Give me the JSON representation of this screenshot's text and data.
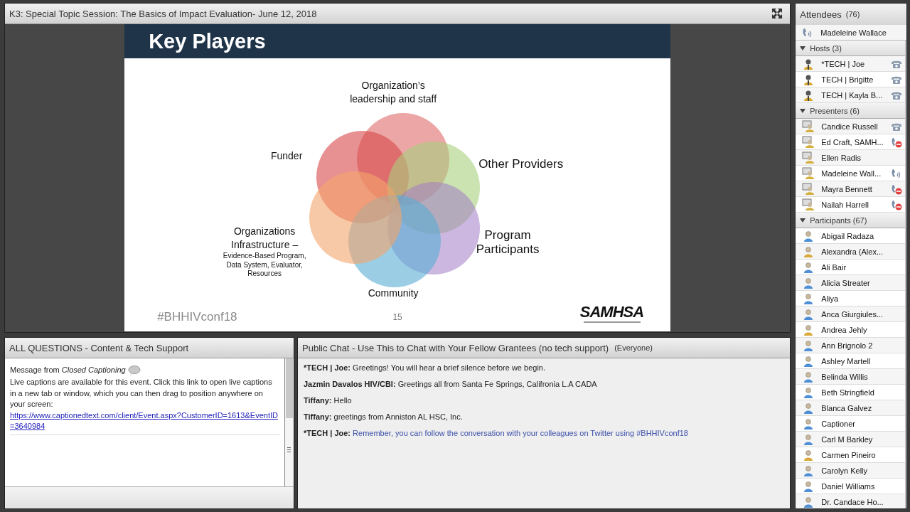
{
  "window": {
    "title": "K3: Special Topic Session: The Basics of Impact Evaluation- June 12, 2018"
  },
  "slide": {
    "title": "Key Players",
    "labels": [
      {
        "text": "Organization’s\nleadership and staff"
      },
      {
        "text": "Funder"
      },
      {
        "text": "Other Providers"
      },
      {
        "text": "Organizations\nInfrastructure –",
        "detail": "Evidence-Based Program,\nData System, Evaluator,\nResources"
      },
      {
        "text": "Program\nParticipants"
      },
      {
        "text": "Community"
      }
    ],
    "hashtag": "#BHHIVconf18",
    "page_number": "15",
    "logo": "SAMHSA"
  },
  "questions_pod": {
    "title": "ALL QUESTIONS - Content & Tech Support",
    "message": {
      "heading": "Message from *Closed Captioning*",
      "body": "Live captions are available for this event. Click this link to open live captions in a new tab or window, which you can then drag to position anywhere on your screen:",
      "link": "https://www.captionedtext.com/client/Event.aspx?CustomerID=1613&EventID=3640984"
    }
  },
  "chat_pod": {
    "title": "Public Chat - Use This to Chat with Your Fellow Grantees (no tech support)",
    "audience": "(Everyone)",
    "messages": [
      {
        "sender": "*TECH | Joe:",
        "text": "Greetings! You will hear a brief silence before we begin.",
        "highlighted": false
      },
      {
        "sender": "Jazmin Davalos HIV/CBI:",
        "text": "Greetings all from Santa Fe Springs, Califronia L.A CADA",
        "highlighted": false
      },
      {
        "sender": "Tiffany:",
        "text": "Hello",
        "highlighted": false
      },
      {
        "sender": "Tiffany:",
        "text": "greetings from Anniston AL HSC, Inc.",
        "highlighted": false
      },
      {
        "sender": "*TECH | Joe:",
        "text": "Remember, you can follow the conversation with your colleagues on Twitter using #BHHIVconf18",
        "highlighted": true
      }
    ]
  },
  "attendees": {
    "title": "Attendees",
    "count": "(76)",
    "current_user": {
      "name": "Madeleine Wallace",
      "kind": "talking"
    },
    "groups": [
      {
        "label": "Hosts (3)",
        "kind": "host",
        "expanded": true,
        "members": [
          {
            "name": "*TECH | Joe",
            "kind": "phone"
          },
          {
            "name": "TECH | Brigitte",
            "kind": "phone"
          },
          {
            "name": "TECH | Kayla B...",
            "kind": "phone"
          }
        ]
      },
      {
        "label": "Presenters (6)",
        "kind": "presenter",
        "expanded": true,
        "members": [
          {
            "name": "Candice Russell",
            "kind": "phone"
          },
          {
            "name": "Ed Craft, SAMH...",
            "kind": "muted"
          },
          {
            "name": "Ellen Radis"
          },
          {
            "name": "Madeleine Wall...",
            "kind": "talking"
          },
          {
            "name": "Mayra Bennett",
            "kind": "muted"
          },
          {
            "name": "Nailah  Harrell",
            "kind": "muted"
          }
        ]
      },
      {
        "label": "Participants (67)",
        "kind": "participant",
        "expanded": true,
        "members": [
          {
            "name": "Abigail Radaza",
            "color": "#4f8fd6"
          },
          {
            "name": "Alexandra (Alex...",
            "color": "#d9a93a"
          },
          {
            "name": "Ali Bair",
            "color": "#4f8fd6"
          },
          {
            "name": "Alicia Streater",
            "color": "#4f8fd6"
          },
          {
            "name": "Aliya",
            "color": "#4f8fd6"
          },
          {
            "name": "Anca Giurgiules...",
            "color": "#4f8fd6"
          },
          {
            "name": "Andrea Jehly",
            "color": "#d9a93a"
          },
          {
            "name": "Ann Brignolo 2",
            "color": "#4f8fd6"
          },
          {
            "name": "Ashley Martell",
            "color": "#4f8fd6"
          },
          {
            "name": "Belinda Willis",
            "color": "#4f8fd6"
          },
          {
            "name": "Beth Stringfield",
            "color": "#4f8fd6"
          },
          {
            "name": "Blanca Galvez",
            "color": "#4f8fd6"
          },
          {
            "name": "Captioner",
            "color": "#4f8fd6"
          },
          {
            "name": "Carl M Barkley",
            "color": "#4f8fd6"
          },
          {
            "name": "Carmen Pineiro",
            "color": "#d9a93a"
          },
          {
            "name": "Carolyn Kelly",
            "color": "#4f8fd6"
          },
          {
            "name": "Daniel Williams",
            "color": "#4f8fd6"
          },
          {
            "name": "Dr. Candace Ho...",
            "color": "#4f8fd6"
          }
        ]
      }
    ]
  }
}
